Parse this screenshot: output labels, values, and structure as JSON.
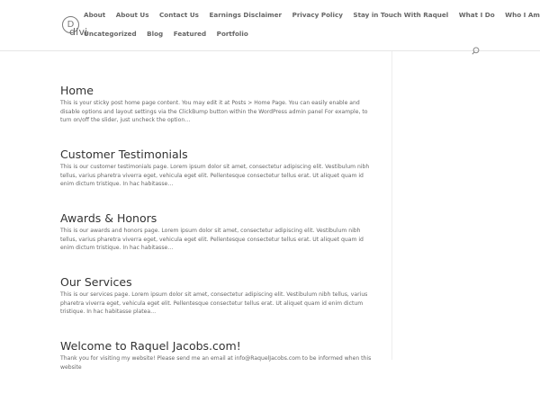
{
  "logo": {
    "letter": "D",
    "text": "divi"
  },
  "nav": {
    "row1": [
      "About",
      "About Us",
      "Contact Us",
      "Earnings Disclaimer",
      "Privacy Policy",
      "Stay in Touch With Raquel",
      "What I Do",
      "Who I Am"
    ],
    "row2": [
      "Uncategorized",
      "Blog",
      "Featured",
      "Portfolio"
    ]
  },
  "search": {
    "icon": "search-icon"
  },
  "posts": [
    {
      "title": "Home",
      "excerpt": "This is your sticky post home page content. You may edit it at Posts > Home Page. You can easily enable and disable options and layout settings via the ClickBump button within the WordPress admin panel For example, to turn on/off the slider, just uncheck the option…"
    },
    {
      "title": "Customer Testimonials",
      "excerpt": "This is our customer testimonials page. Lorem ipsum dolor sit amet, consectetur adipiscing elit. Vestibulum nibh tellus, varius pharetra viverra eget, vehicula eget elit. Pellentesque consectetur tellus erat. Ut aliquet quam id enim dictum tristique. In hac habitasse…"
    },
    {
      "title": "Awards & Honors",
      "excerpt": "This is our awards and honors page. Lorem ipsum dolor sit amet, consectetur adipiscing elit. Vestibulum nibh tellus, varius pharetra viverra eget, vehicula eget elit. Pellentesque consectetur tellus erat. Ut aliquet quam id enim dictum tristique. In hac habitasse…"
    },
    {
      "title": "Our Services",
      "excerpt": "This is our services page. Lorem ipsum dolor sit amet, consectetur adipiscing elit. Vestibulum nibh tellus, varius pharetra viverra eget, vehicula eget elit. Pellentesque consectetur tellus erat. Ut aliquet quam id enim dictum tristique. In hac habitasse platea…"
    },
    {
      "title": "Welcome to Raquel Jacobs.com!",
      "excerpt": "Thank you for visiting my website! Please send me an email at info@RaquelJacobs.com to be informed when this website"
    }
  ]
}
